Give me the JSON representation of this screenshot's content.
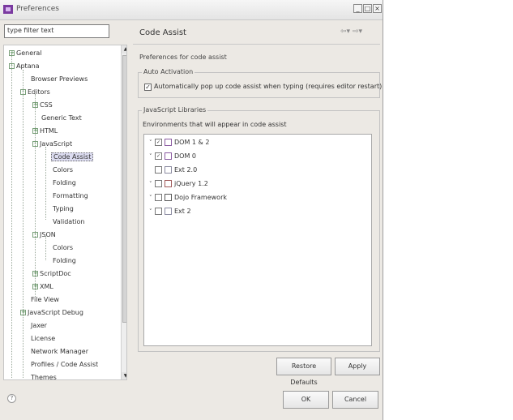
{
  "window": {
    "title": "Preferences"
  },
  "filter": {
    "value": "type filter text"
  },
  "tree": {
    "items": [
      {
        "label": "General",
        "expander": "+"
      },
      {
        "label": "Aptana",
        "expander": "-"
      },
      {
        "label": "Browser Previews",
        "expander": ""
      },
      {
        "label": "Editors",
        "expander": "-"
      },
      {
        "label": "CSS",
        "expander": "+"
      },
      {
        "label": "Generic Text",
        "expander": ""
      },
      {
        "label": "HTML",
        "expander": "+"
      },
      {
        "label": "JavaScript",
        "expander": "-"
      },
      {
        "label": "Code Assist",
        "expander": ""
      },
      {
        "label": "Colors",
        "expander": ""
      },
      {
        "label": "Folding",
        "expander": ""
      },
      {
        "label": "Formatting",
        "expander": ""
      },
      {
        "label": "Typing",
        "expander": ""
      },
      {
        "label": "Validation",
        "expander": ""
      },
      {
        "label": "JSON",
        "expander": "-"
      },
      {
        "label": "Colors",
        "expander": ""
      },
      {
        "label": "Folding",
        "expander": ""
      },
      {
        "label": "ScriptDoc",
        "expander": "+"
      },
      {
        "label": "XML",
        "expander": "+"
      },
      {
        "label": "File View",
        "expander": ""
      },
      {
        "label": "JavaScript Debug",
        "expander": "+"
      },
      {
        "label": "Jaxer",
        "expander": ""
      },
      {
        "label": "License",
        "expander": ""
      },
      {
        "label": "Network Manager",
        "expander": ""
      },
      {
        "label": "Profiles / Code Assist",
        "expander": ""
      },
      {
        "label": "Themes",
        "expander": ""
      }
    ]
  },
  "page": {
    "title": "Code Assist",
    "description": "Preferences for code assist",
    "auto_activation": {
      "title": "Auto Activation",
      "checkbox_label": "Automatically pop up code assist when typing (requires editor restart)",
      "checked": true
    },
    "libraries": {
      "title": "JavaScript Libraries",
      "description": "Environments that will appear in code assist",
      "items": [
        {
          "label": "DOM 1 & 2",
          "expandable": true,
          "checked": true
        },
        {
          "label": "DOM 0",
          "expandable": true,
          "checked": true
        },
        {
          "label": "Ext 2.0",
          "expandable": false,
          "checked": false
        },
        {
          "label": "jQuery 1.2",
          "expandable": true,
          "checked": false
        },
        {
          "label": "Dojo Framework",
          "expandable": true,
          "checked": false
        },
        {
          "label": "Ext 2",
          "expandable": true,
          "checked": false
        }
      ]
    },
    "restore_defaults_label": "Restore Defaults",
    "apply_label": "Apply"
  },
  "footer": {
    "help_label": "?",
    "ok_label": "OK",
    "cancel_label": "Cancel"
  }
}
